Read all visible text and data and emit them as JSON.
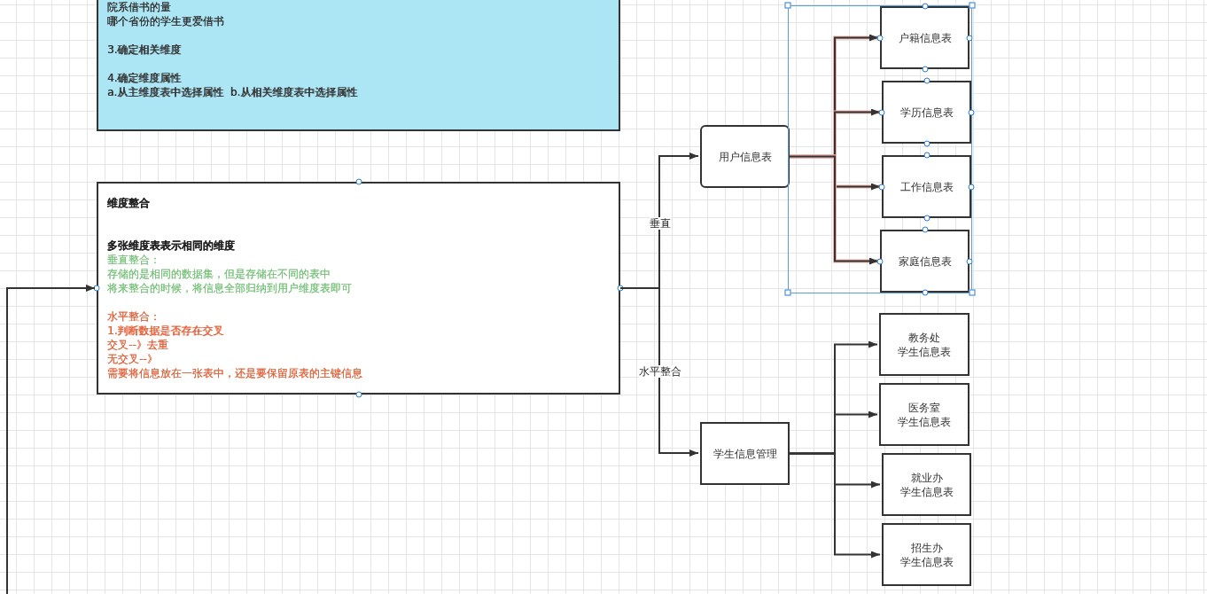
{
  "notes": [
    {
      "kind": "blue",
      "hovered": false,
      "paragraphs": [
        {
          "color": "#333333",
          "bold": false,
          "spaced": false,
          "lines": [
            "院系借书的量",
            "哪个省份的学生更爱借书"
          ]
        },
        {
          "color": "#333333",
          "bold": false,
          "spaced": true,
          "lines": [
            "3.确定相关维度"
          ]
        },
        {
          "color": "#333333",
          "bold": false,
          "spaced": true,
          "lines": [
            "4.确定维度属性",
            "a.从主维度表中选择属性  b.从相关维度表中选择属性"
          ]
        }
      ]
    },
    {
      "kind": "white",
      "hovered": true,
      "paragraphs": [
        {
          "color": "#222222",
          "bold": true,
          "spaced": false,
          "lines": [
            "维度整合"
          ]
        },
        {
          "color": "#222222",
          "bold": true,
          "spaced": true,
          "lines": [
            "多张维度表表示相同的维度"
          ]
        },
        {
          "color": "#7cc47f",
          "bold": false,
          "spaced": false,
          "lines": [
            "垂直整合：",
            "存储的是相同的数据集，但是存储在不同的表中",
            "将来整合的时候，将信息全部归纳到用户维度表即可"
          ]
        },
        {
          "color": "#e4643e",
          "bold": false,
          "spaced": true,
          "lines": [
            "水平整合：",
            "1.判断数据是否存在交叉",
            "交叉--》去重",
            "无交叉--》",
            "需要将信息放在一张表中，还是要保留原表的主键信息"
          ]
        }
      ]
    }
  ],
  "edge_labels": [
    "垂直",
    "水平整合"
  ],
  "tables": [
    {
      "kind": "rounded",
      "selected": false,
      "lines": [
        "用户信息表"
      ]
    },
    {
      "kind": "box",
      "selected": true,
      "lines": [
        "户籍信息表"
      ]
    },
    {
      "kind": "box",
      "selected": true,
      "lines": [
        "学历信息表"
      ]
    },
    {
      "kind": "box",
      "selected": true,
      "lines": [
        "工作信息表"
      ]
    },
    {
      "kind": "box",
      "selected": true,
      "lines": [
        "家庭信息表"
      ]
    },
    {
      "kind": "box",
      "selected": false,
      "lines": [
        "学生信息管理"
      ]
    },
    {
      "kind": "box",
      "selected": false,
      "lines": [
        "教务处",
        "学生信息表"
      ]
    },
    {
      "kind": "box",
      "selected": false,
      "lines": [
        "医务室",
        "学生信息表"
      ]
    },
    {
      "kind": "box",
      "selected": false,
      "lines": [
        "就业办",
        "学生信息表"
      ]
    },
    {
      "kind": "box",
      "selected": false,
      "lines": [
        "招生办",
        "学生信息表"
      ]
    }
  ]
}
